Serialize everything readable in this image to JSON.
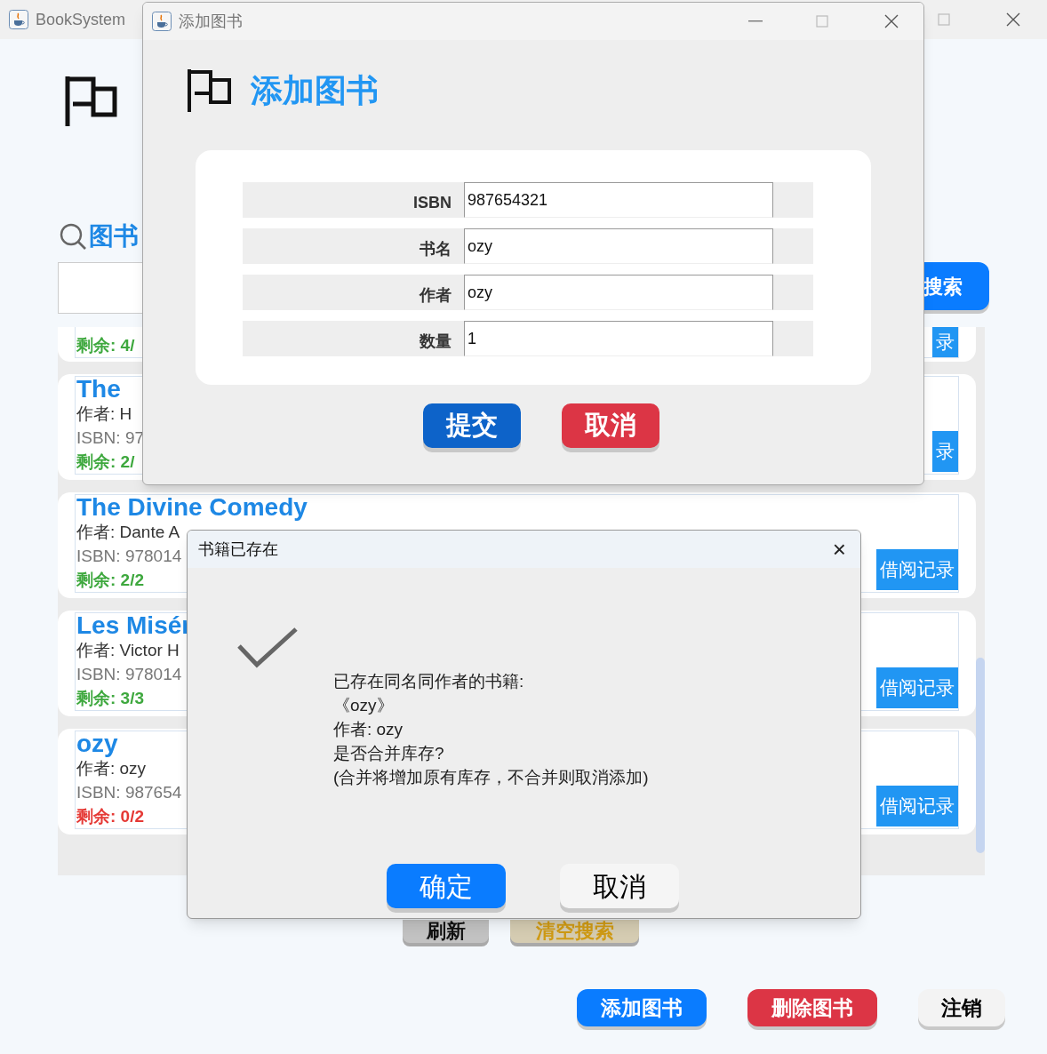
{
  "main_window": {
    "title": "BookSystem",
    "search_heading": "图书",
    "search_button": "搜索",
    "books": [
      {
        "stock": "剩余: 4/",
        "color": "#3ea83e",
        "borrow_button": "录"
      },
      {
        "title": "The",
        "author": "作者: H",
        "isbn": "ISBN: 97",
        "stock": "剩余: 2/",
        "color": "#3ea83e",
        "borrow_button": "录"
      },
      {
        "title": "The Divine Comedy",
        "author": "作者: Dante A",
        "isbn": "ISBN: 978014",
        "stock": "剩余: 2/2",
        "color": "#3ea83e",
        "borrow_button": "借阅记录"
      },
      {
        "title": "Les Misér",
        "author": "作者: Victor H",
        "isbn": "ISBN: 978014",
        "stock": "剩余: 3/3",
        "color": "#3ea83e",
        "borrow_button": "借阅记录"
      },
      {
        "title": "ozy",
        "author": "作者: ozy",
        "isbn": "ISBN: 987654",
        "stock": "剩余: 0/2",
        "color": "#e53935",
        "borrow_button": "借阅记录"
      }
    ],
    "list_buttons": [
      {
        "label": "刷新",
        "kind": "refresh"
      },
      {
        "label": "清空搜索",
        "kind": "clear"
      }
    ],
    "bottom_buttons": [
      {
        "label": "添加图书",
        "kind": "primary"
      },
      {
        "label": "删除图书",
        "kind": "danger"
      },
      {
        "label": "注销",
        "kind": "plain"
      }
    ]
  },
  "add_dialog": {
    "title": "添加图书",
    "heading": "添加图书",
    "fields": [
      {
        "label": "ISBN",
        "value": "987654321"
      },
      {
        "label": "书名",
        "value": "ozy"
      },
      {
        "label": "作者",
        "value": "ozy"
      },
      {
        "label": "数量",
        "value": "1"
      }
    ],
    "buttons": [
      {
        "label": "提交",
        "kind": "primary"
      },
      {
        "label": "取消",
        "kind": "danger"
      }
    ]
  },
  "confirm_dialog": {
    "title": "书籍已存在",
    "close": "×",
    "message": [
      "已存在同名同作者的书籍:",
      "《ozy》",
      "作者: ozy",
      "是否合并库存?",
      "(合并将增加原有库存，不合并则取消添加)"
    ],
    "buttons": [
      {
        "label": "确定",
        "kind": "primary"
      },
      {
        "label": "取消",
        "kind": "plain"
      }
    ]
  }
}
